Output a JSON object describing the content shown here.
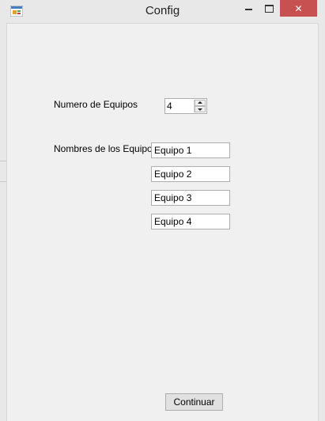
{
  "window": {
    "title": "Config",
    "close_symbol": "✕",
    "icons": {
      "app": "app-form-icon",
      "minimize": "minimize-icon",
      "maximize": "maximize-icon",
      "close": "close-icon"
    },
    "colors": {
      "close_button": "#c75050",
      "background": "#f0f0f0"
    }
  },
  "form": {
    "team_count_label": "Numero de Equipos",
    "team_count_value": "4",
    "team_names_label": "Nombres de los Equipos",
    "team_names": [
      "Equipo 1",
      "Equipo 2",
      "Equipo 3",
      "Equipo 4"
    ],
    "continue_label": "Continuar"
  }
}
